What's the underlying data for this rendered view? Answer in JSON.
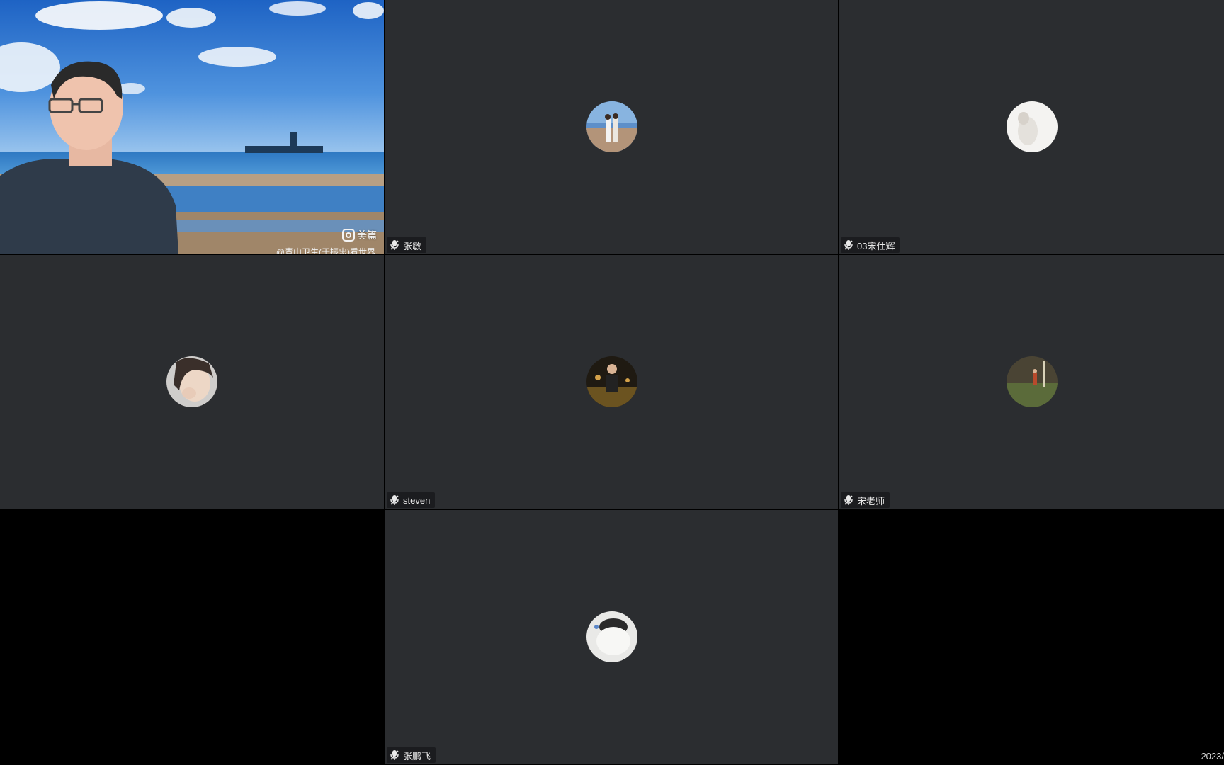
{
  "participants": [
    {
      "name": "张敏"
    },
    {
      "name": "03宋仕辉"
    },
    {
      "name": "steven"
    },
    {
      "name": "宋老师"
    },
    {
      "name": "张鹏飞"
    }
  ],
  "video": {
    "watermark": "美篇",
    "caption": "@青山卫生(于振忠)看世界"
  },
  "timestamp": "2023/",
  "colors": {
    "tile_bg": "#2b2d30",
    "grid_bg": "#000000",
    "nametag_bg": "#191a1c"
  }
}
